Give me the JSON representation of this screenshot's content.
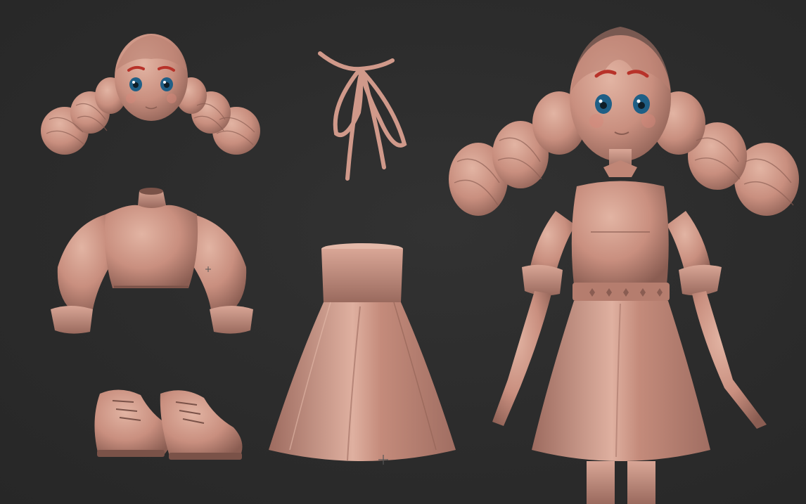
{
  "viewport": {
    "background": "#2b2b2b",
    "clay_color": "#c98f7f",
    "clay_shadow": "#8a5d52",
    "clay_highlight": "#e2b4a3",
    "eyebrow_color": "#b8322a",
    "iris_color": "#1f5f86"
  },
  "parts": [
    {
      "id": "head",
      "icon": "head-sculpt"
    },
    {
      "id": "ribbon",
      "icon": "bow-ribbon"
    },
    {
      "id": "blouse",
      "icon": "blouse-sculpt"
    },
    {
      "id": "skirt",
      "icon": "skirt-sculpt"
    },
    {
      "id": "shoes",
      "icon": "shoe-pair"
    },
    {
      "id": "full-character",
      "icon": "character-figure"
    }
  ]
}
